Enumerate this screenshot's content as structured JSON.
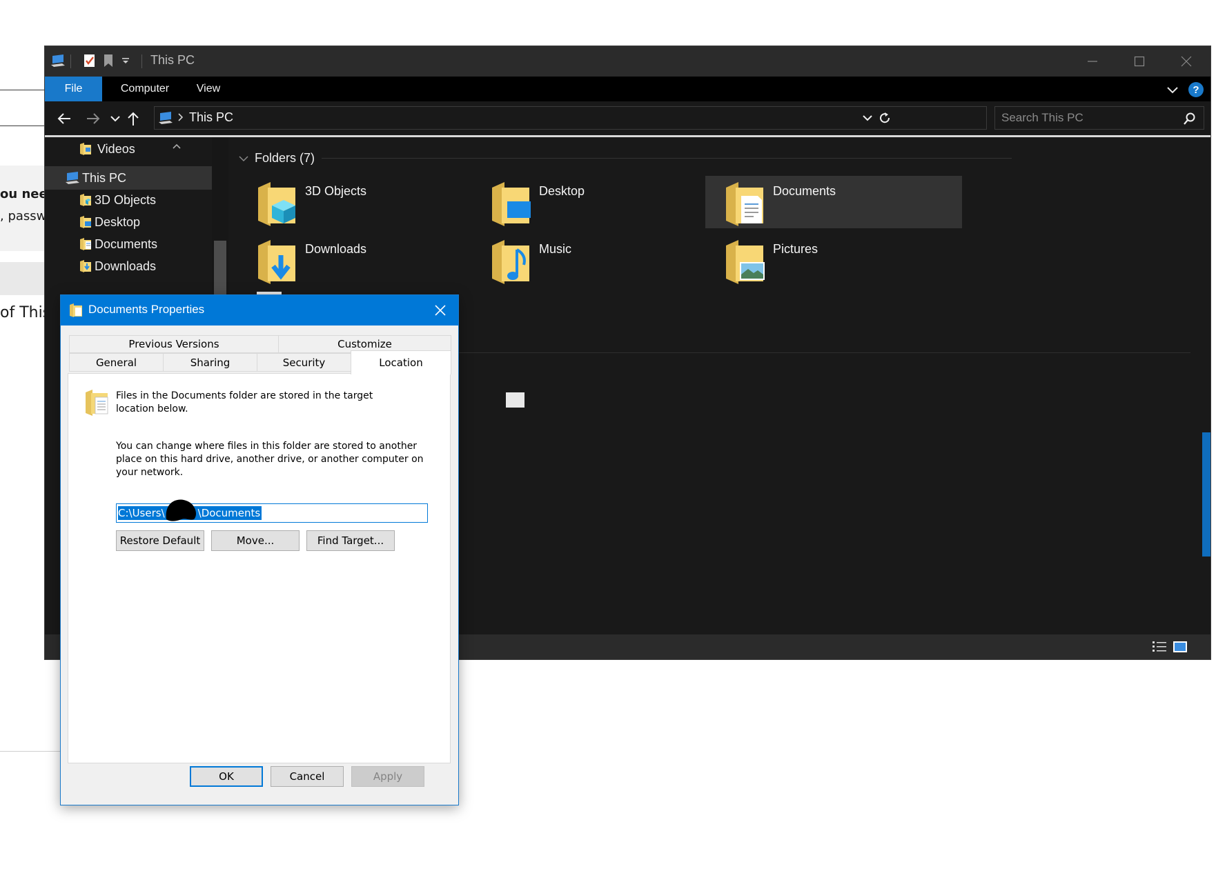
{
  "background_page": {
    "snippet_1": "ou need",
    "snippet_2": ", passw",
    "snippet_3": "of This"
  },
  "explorer": {
    "title": "This PC",
    "ribbon_tabs": [
      "File",
      "Computer",
      "View"
    ],
    "address": {
      "path": "This PC"
    },
    "search": {
      "placeholder": "Search This PC"
    },
    "sidebar": {
      "items": [
        {
          "label": "Videos",
          "icon": "videos-folder-icon"
        },
        {
          "label": "This PC",
          "icon": "this-pc-icon",
          "selected": true
        },
        {
          "label": "3D Objects",
          "icon": "3d-objects-folder-icon"
        },
        {
          "label": "Desktop",
          "icon": "desktop-folder-icon"
        },
        {
          "label": "Documents",
          "icon": "documents-folder-icon"
        },
        {
          "label": "Downloads",
          "icon": "downloads-folder-icon"
        }
      ]
    },
    "folders_section": {
      "title": "Folders (7)"
    },
    "folders": [
      {
        "label": "3D Objects",
        "icon": "3d-objects-folder-icon"
      },
      {
        "label": "Desktop",
        "icon": "desktop-folder-icon"
      },
      {
        "label": "Documents",
        "icon": "documents-folder-icon",
        "selected": true
      },
      {
        "label": "Downloads",
        "icon": "downloads-folder-icon"
      },
      {
        "label": "Music",
        "icon": "music-folder-icon"
      },
      {
        "label": "Pictures",
        "icon": "pictures-folder-icon"
      }
    ],
    "colors": {
      "accent": "#1979ca",
      "background": "#191919",
      "selected_tile": "#333333"
    }
  },
  "dialog": {
    "title": "Documents Properties",
    "tabs_row_1": [
      "Previous Versions",
      "Customize"
    ],
    "tabs_row_2": [
      "General",
      "Sharing",
      "Security",
      "Location"
    ],
    "active_tab": "Location",
    "info_text": "Files in the Documents folder are stored in the target location below.",
    "info_line_1": "Files in the Documents folder are stored in the target",
    "info_line_2": "location below.",
    "change_line_1": "You can change where files in this folder are stored to another",
    "change_line_2": "place on this hard drive, another drive, or another computer on",
    "change_line_3": "your network.",
    "path_prefix": "C:\\Users\\",
    "path_suffix": "\\Documents",
    "buttons": {
      "restore_default": "Restore Default",
      "move": "Move...",
      "find_target": "Find Target...",
      "ok": "OK",
      "cancel": "Cancel",
      "apply": "Apply"
    },
    "colors": {
      "title_bar": "#0078d7",
      "selection": "#0078d7"
    }
  }
}
